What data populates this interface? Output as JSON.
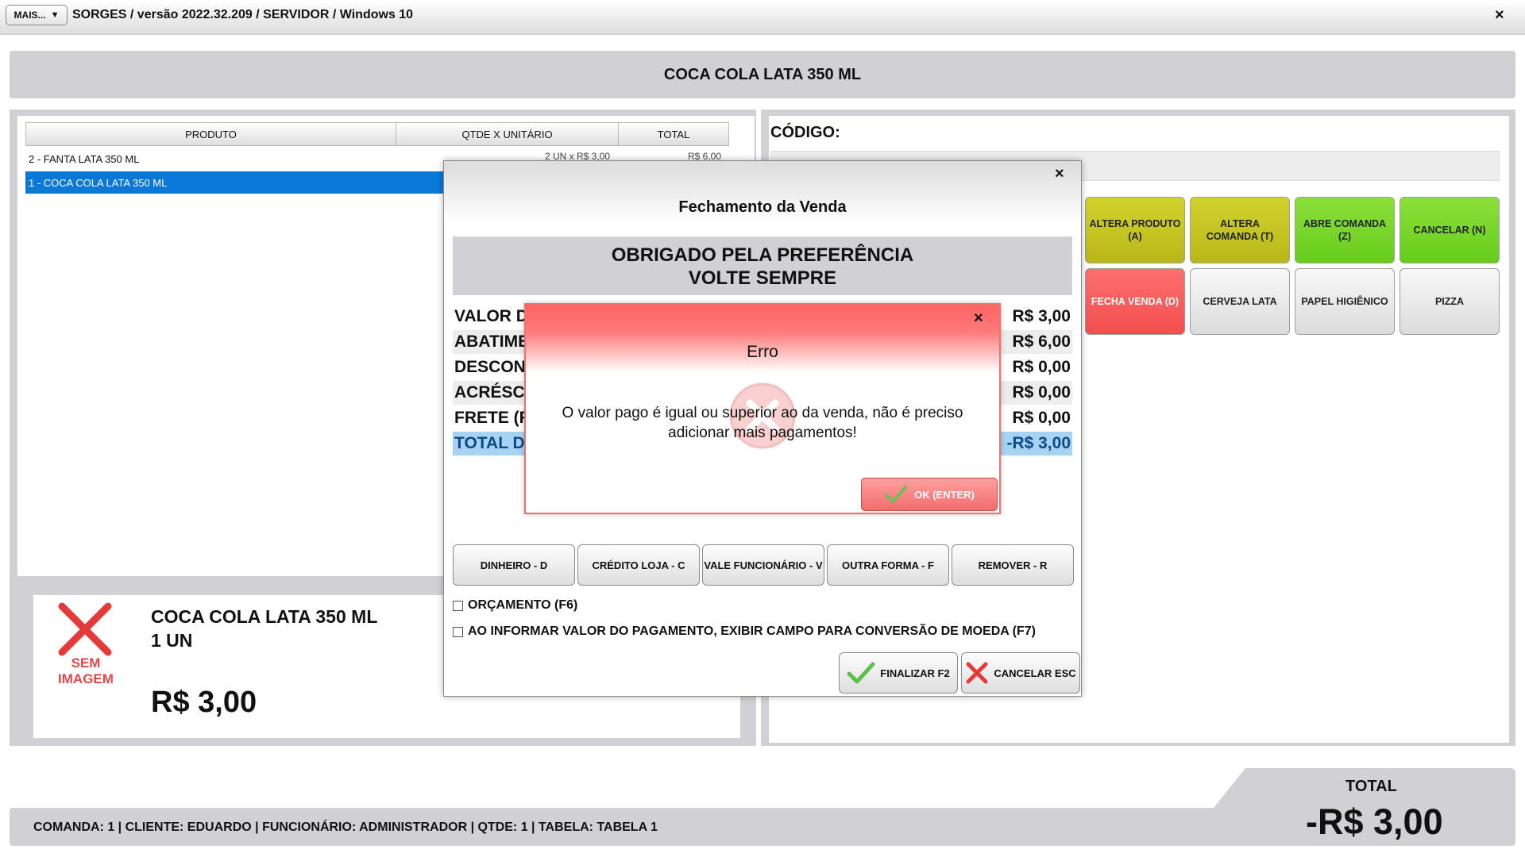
{
  "titlebar": {
    "mais_label": "MAIS...",
    "title": "SORGES / versão 2022.32.209 / SERVIDOR / Windows 10",
    "close": "×"
  },
  "banner": {
    "product": "COCA COLA LATA 350 ML"
  },
  "table": {
    "headers": [
      "PRODUTO",
      "QTDE X UNITÁRIO",
      "TOTAL"
    ],
    "rows": [
      {
        "produto": "2 - FANTA LATA 350 ML",
        "qtde": "2 UN x R$ 3,00",
        "total": "R$ 6,00"
      },
      {
        "produto": "1 - COCA COLA LATA 350 ML",
        "qtde": "",
        "total": ""
      }
    ]
  },
  "detail": {
    "no_image_text": "SEM IMAGEM",
    "name": "COCA COLA LATA 350 ML",
    "qty": "1  UN",
    "price": "R$ 3,00"
  },
  "codigo": {
    "label": "CÓDIGO:"
  },
  "tiles": [
    {
      "label": "ALTERA PRODUTO (A)",
      "style": "olive"
    },
    {
      "label": "ALTERA COMANDA (T)",
      "style": "olive"
    },
    {
      "label": "ABRE COMANDA (Z)",
      "style": "green"
    },
    {
      "label": "CANCELAR (N)",
      "style": "green"
    },
    {
      "label": "FECHA VENDA (D)",
      "style": "red"
    },
    {
      "label": "CERVEJA LATA",
      "style": "gray"
    },
    {
      "label": "PAPEL HIGIÊNICO",
      "style": "gray"
    },
    {
      "label": "PIZZA",
      "style": "gray"
    }
  ],
  "status": {
    "text": "COMANDA: 1  |  CLIENTE: EDUARDO  |  FUNCIONÁRIO: ADMINISTRADOR  |  QTDE: 1  |  TABELA: TABELA 1",
    "total_label": "TOTAL",
    "total_value": "-R$ 3,00"
  },
  "fechamento": {
    "close": "×",
    "title": "Fechamento da Venda",
    "banner_line1": "OBRIGADO PELA PREFERÊNCIA",
    "banner_line2": "VOLTE SEMPRE",
    "rows": [
      {
        "label": "VALOR D",
        "value": "R$ 3,00"
      },
      {
        "label": "ABATIME",
        "value": "R$ 6,00"
      },
      {
        "label": "DESCON",
        "value": "R$ 0,00"
      },
      {
        "label": "ACRÉSC",
        "value": "R$ 0,00"
      },
      {
        "label": "FRETE (F",
        "value": "R$ 0,00"
      },
      {
        "label": "TOTAL D",
        "value": "-R$ 3,00"
      }
    ],
    "pay_buttons": [
      "DINHEIRO - D",
      "CRÉDITO LOJA - C",
      "VALE FUNCIONÁRIO - V",
      "OUTRA FORMA - F",
      "REMOVER - R"
    ],
    "checkbox_orcamento": "ORÇAMENTO (F6)",
    "checkbox_moeda": "AO INFORMAR VALOR DO PAGAMENTO, EXIBIR CAMPO PARA CONVERSÃO DE MOEDA (F7)",
    "finalizar": "FINALIZAR F2",
    "cancelar": "CANCELAR ESC"
  },
  "erro": {
    "close": "×",
    "title": "Erro",
    "message": "O valor pago é igual ou superior ao da venda, não é preciso adicionar mais pagamentos!",
    "ok": "OK (ENTER)"
  }
}
